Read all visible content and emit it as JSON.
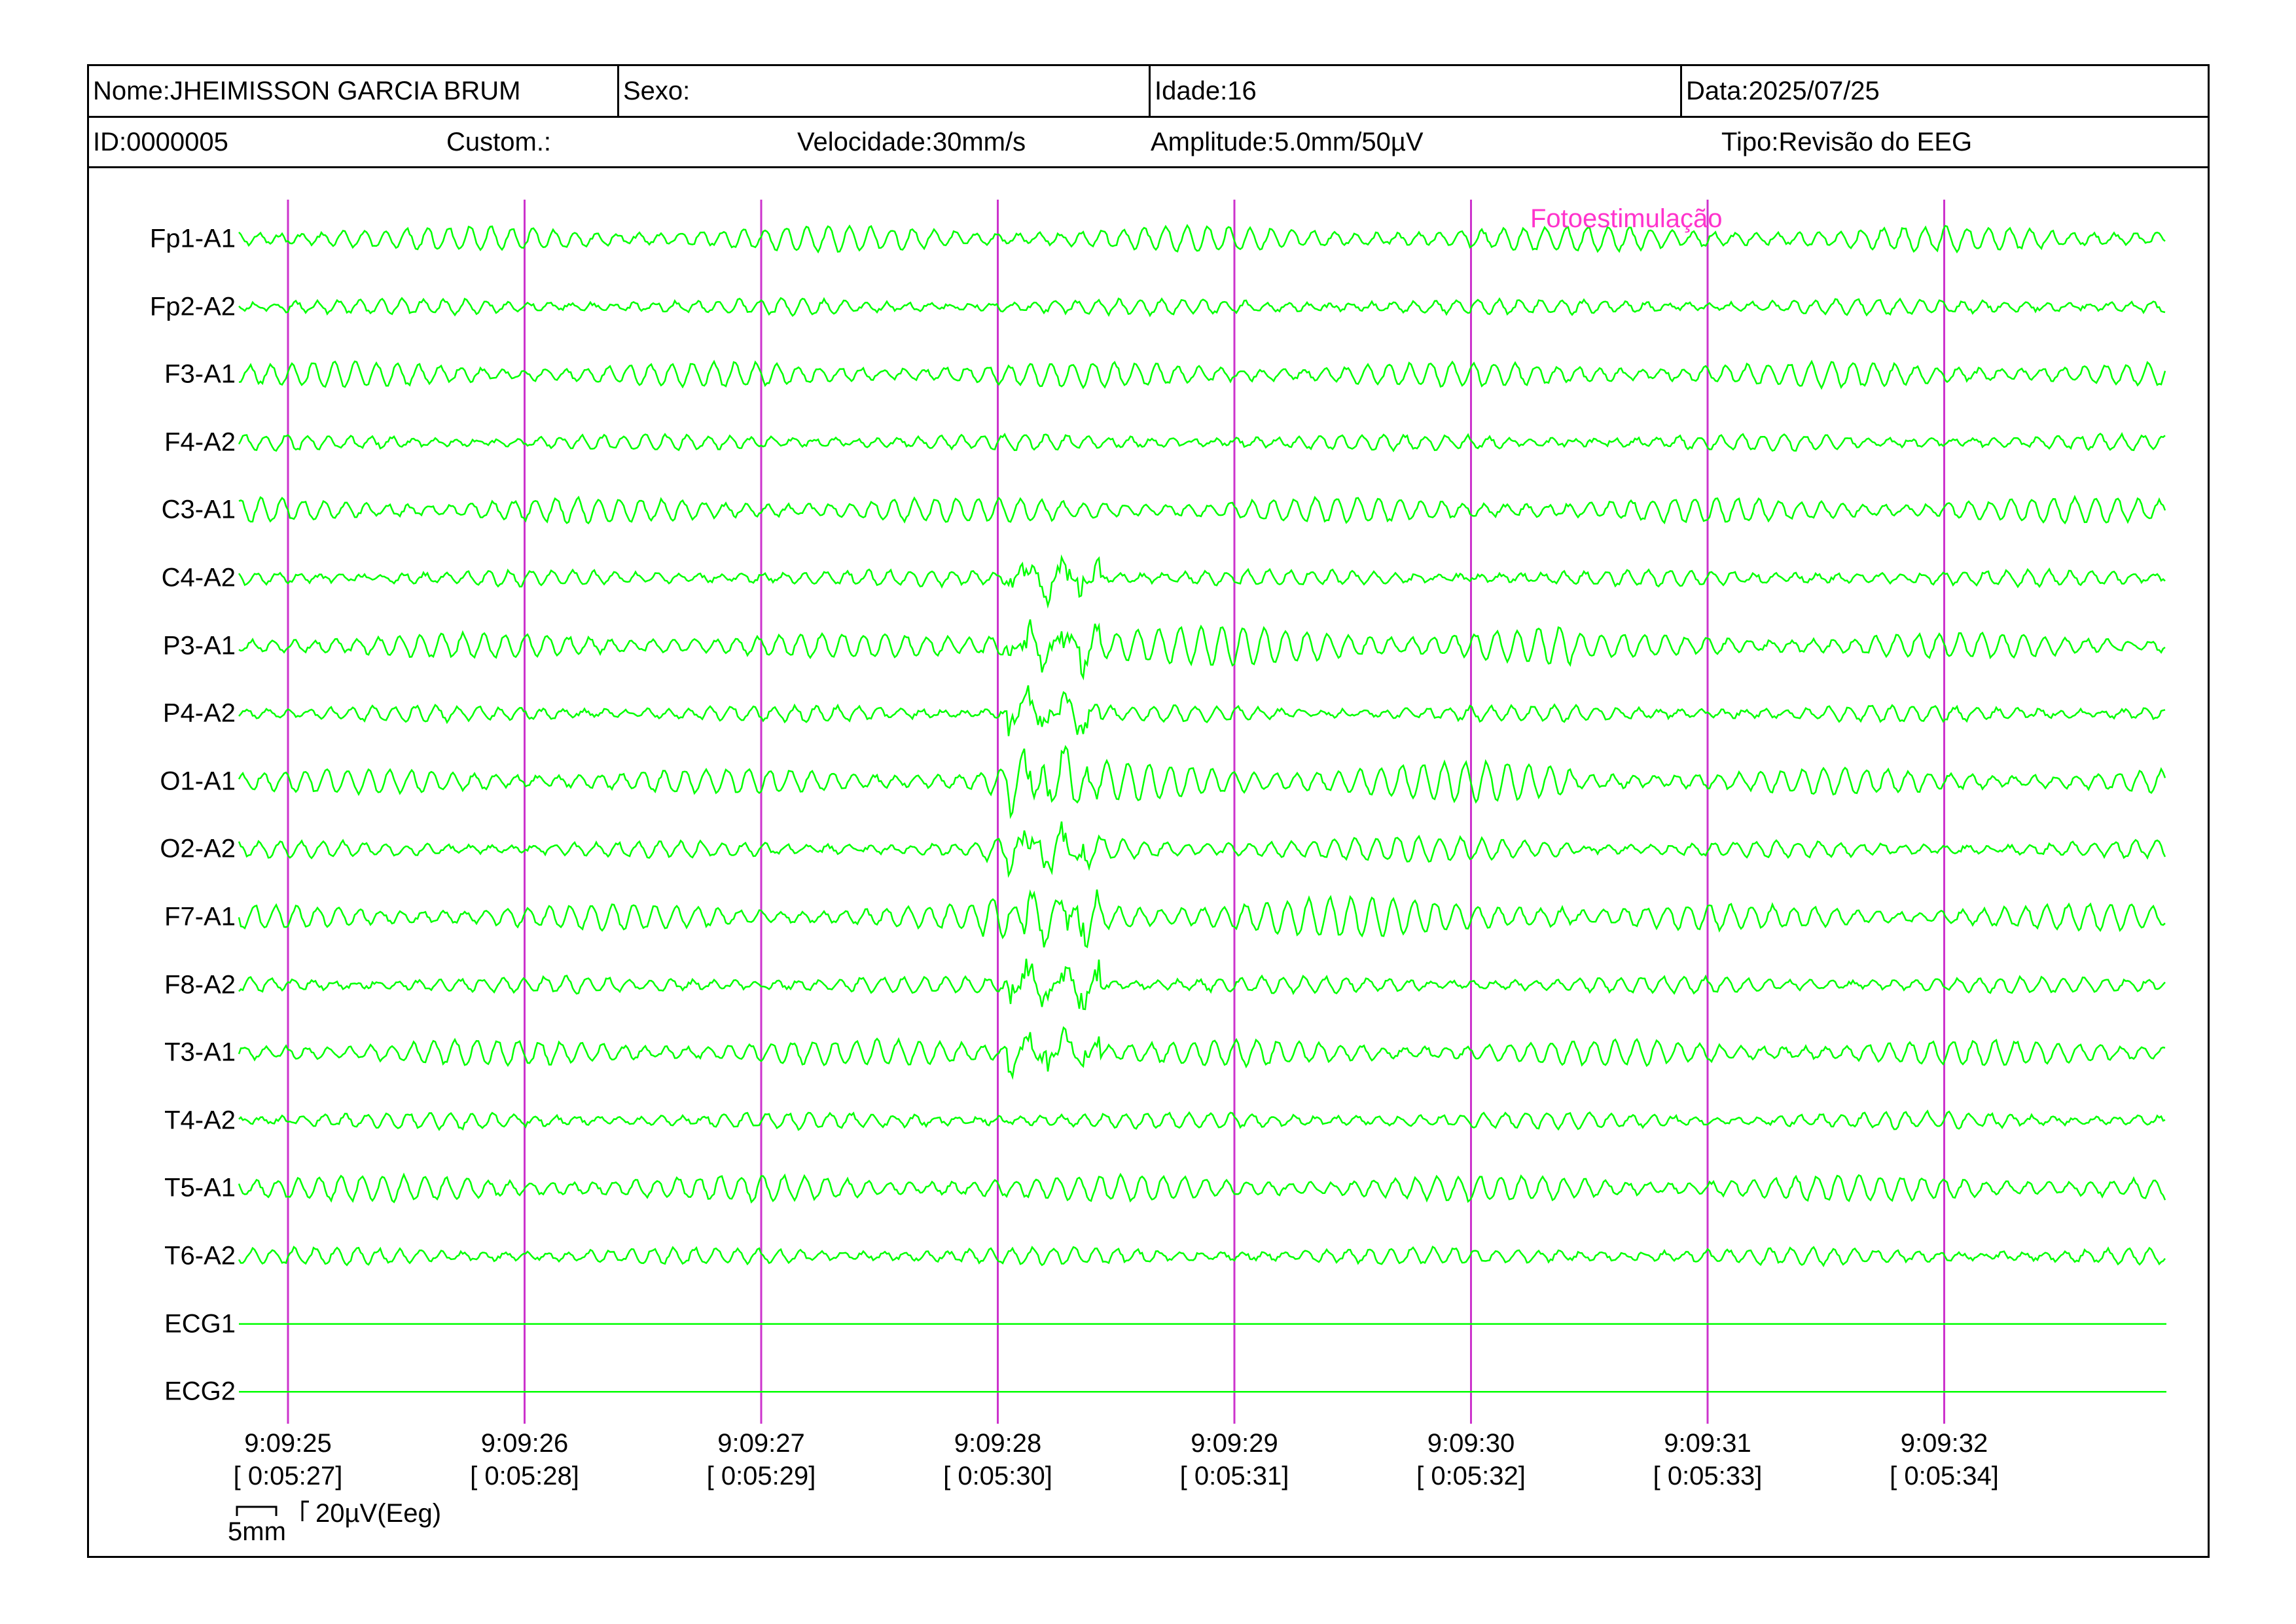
{
  "header": {
    "name_label": "Nome:JHEIMISSON GARCIA BRUM",
    "sex_label": "Sexo:",
    "age_label": "Idade:16",
    "date_label": "Data:2025/07/25",
    "id_label": "ID:0000005",
    "custom_label": "Custom.:",
    "speed_label": "Velocidade:30mm/s",
    "amplitude_label": "Amplitude:5.0mm/50µV",
    "type_label": "Tipo:Revisão do EEG"
  },
  "channels": [
    {
      "label": "Fp1-A1"
    },
    {
      "label": "Fp2-A2"
    },
    {
      "label": "F3-A1"
    },
    {
      "label": "F4-A2"
    },
    {
      "label": "C3-A1"
    },
    {
      "label": "C4-A2"
    },
    {
      "label": "P3-A1"
    },
    {
      "label": "P4-A2"
    },
    {
      "label": "O1-A1"
    },
    {
      "label": "O2-A2"
    },
    {
      "label": "F7-A1"
    },
    {
      "label": "F8-A2"
    },
    {
      "label": "T3-A1"
    },
    {
      "label": "T4-A2"
    },
    {
      "label": "T5-A1"
    },
    {
      "label": "T6-A2"
    },
    {
      "label": "ECG1"
    },
    {
      "label": "ECG2"
    }
  ],
  "time_marks": [
    {
      "clock": "9:09:25",
      "elapsed": "[ 0:05:27]"
    },
    {
      "clock": "9:09:26",
      "elapsed": "[ 0:05:28]"
    },
    {
      "clock": "9:09:27",
      "elapsed": "[ 0:05:29]"
    },
    {
      "clock": "9:09:28",
      "elapsed": "[ 0:05:30]"
    },
    {
      "clock": "9:09:29",
      "elapsed": "[ 0:05:31]"
    },
    {
      "clock": "9:09:30",
      "elapsed": "[ 0:05:32]"
    },
    {
      "clock": "9:09:31",
      "elapsed": "[ 0:05:33]"
    },
    {
      "clock": "9:09:32",
      "elapsed": "[ 0:05:34]"
    }
  ],
  "event": {
    "label": "Fotoestimulação"
  },
  "scale": {
    "time_label": "5mm",
    "amp_label": "20µV(Eeg)"
  },
  "colors": {
    "trace": "#00ff00",
    "marker": "#cc33cc",
    "event": "#ff33cc"
  }
}
